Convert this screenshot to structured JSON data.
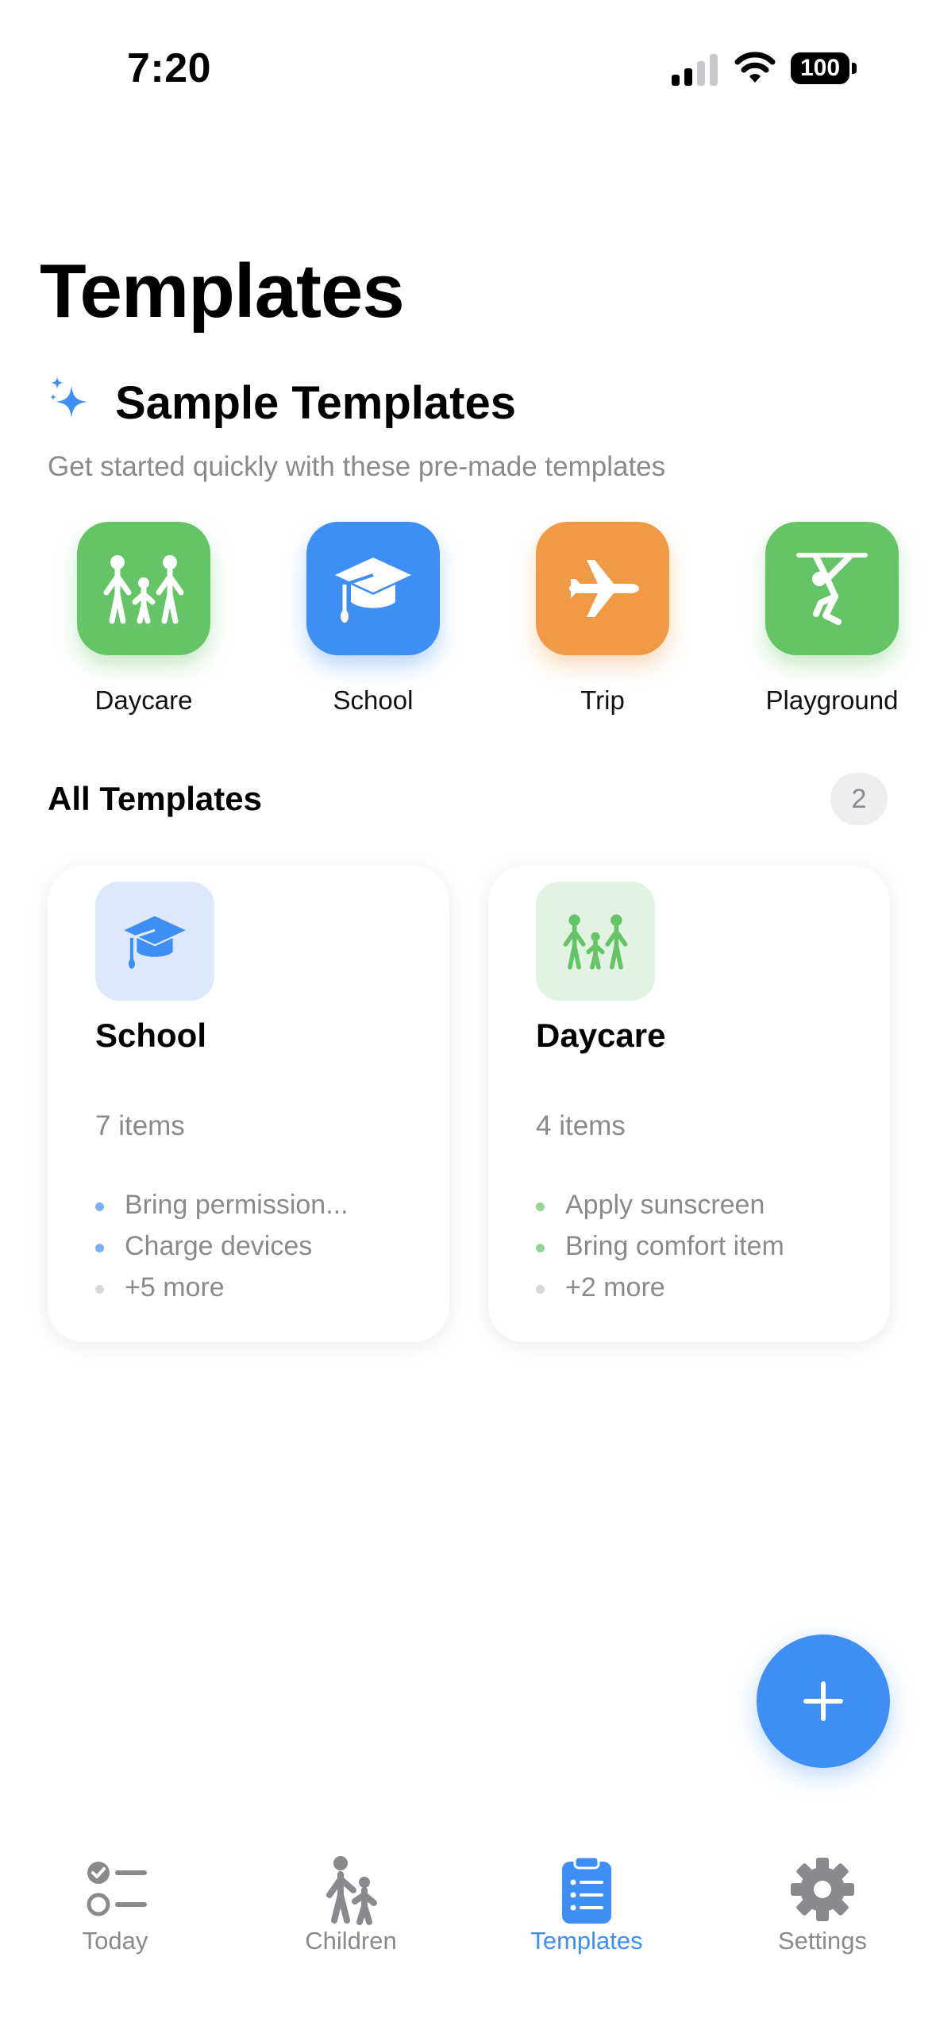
{
  "status_bar": {
    "time": "7:20",
    "battery": "100"
  },
  "header": {
    "title": "Templates"
  },
  "sample_section": {
    "title": "Sample Templates",
    "subtitle": "Get started quickly with these pre-made templates",
    "items": [
      {
        "label": "Daycare",
        "icon": "family-icon",
        "color": "#65c466"
      },
      {
        "label": "School",
        "icon": "graduation-cap-icon",
        "color": "#3f8ef3"
      },
      {
        "label": "Trip",
        "icon": "airplane-icon",
        "color": "#f09a45"
      },
      {
        "label": "Playground",
        "icon": "climbing-figure-icon",
        "color": "#65c466"
      }
    ]
  },
  "all_templates": {
    "title": "All Templates",
    "count": "2",
    "cards": [
      {
        "title": "School",
        "icon": "graduation-cap-icon",
        "count_text": "7 items",
        "accent": "#3f8ef3",
        "items": [
          "Bring permission...",
          "Charge devices",
          "+5 more"
        ]
      },
      {
        "title": "Daycare",
        "icon": "family-icon",
        "count_text": "4 items",
        "accent": "#65c466",
        "items": [
          "Apply sunscreen",
          "Bring comfort item",
          "+2 more"
        ]
      }
    ]
  },
  "fab": {
    "icon": "plus-icon"
  },
  "tab_bar": {
    "active": "Templates",
    "tabs": [
      {
        "label": "Today",
        "icon": "checklist-icon"
      },
      {
        "label": "Children",
        "icon": "parent-child-icon"
      },
      {
        "label": "Templates",
        "icon": "clipboard-list-icon"
      },
      {
        "label": "Settings",
        "icon": "gear-icon"
      }
    ]
  },
  "colors": {
    "accent": "#3f8ef3",
    "green": "#65c466",
    "orange": "#f09a45",
    "secondary_text": "#8a8a8e"
  }
}
